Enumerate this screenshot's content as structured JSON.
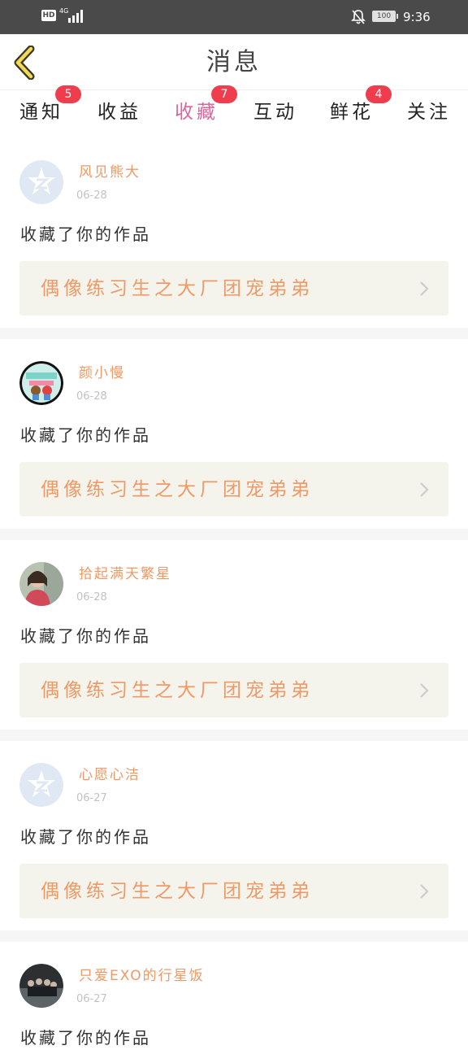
{
  "status_bar": {
    "hd": "HD",
    "network": "4G",
    "network_sub": "46",
    "battery": "100",
    "time": "9:36"
  },
  "header": {
    "title": "消息",
    "back_icon": "chevron-left-icon"
  },
  "tabs": [
    {
      "label": "通知",
      "badge": "5"
    },
    {
      "label": "收益",
      "badge": ""
    },
    {
      "label": "收藏",
      "badge": "7",
      "active": true
    },
    {
      "label": "互动",
      "badge": ""
    },
    {
      "label": "鲜花",
      "badge": "4"
    },
    {
      "label": "关注",
      "badge": ""
    }
  ],
  "colors": {
    "accent": "#d9679b",
    "badge": "#f03d4e",
    "username": "#ee9966",
    "work_title": "#ef9a66",
    "card_bg": "#f4f4ec"
  },
  "messages": [
    {
      "user": "风见熊大",
      "date": "06-28",
      "action": "收藏了你的作品",
      "work": "偶像练习生之大厂团宠弟弟",
      "avatar": "default-avatar-icon"
    },
    {
      "user": "颜小慢",
      "date": "06-28",
      "action": "收藏了你的作品",
      "work": "偶像练习生之大厂团宠弟弟",
      "avatar": "cartoon-couple-avatar"
    },
    {
      "user": "拾起满天繁星",
      "date": "06-28",
      "action": "收藏了你的作品",
      "work": "偶像练习生之大厂团宠弟弟",
      "avatar": "photo-girl-avatar"
    },
    {
      "user": "心愿心洁",
      "date": "06-27",
      "action": "收藏了你的作品",
      "work": "偶像练习生之大厂团宠弟弟",
      "avatar": "default-avatar-icon"
    },
    {
      "user": "只爱EXO的行星饭",
      "date": "06-27",
      "action": "收藏了你的作品",
      "work": "",
      "avatar": "group-photo-avatar"
    }
  ]
}
